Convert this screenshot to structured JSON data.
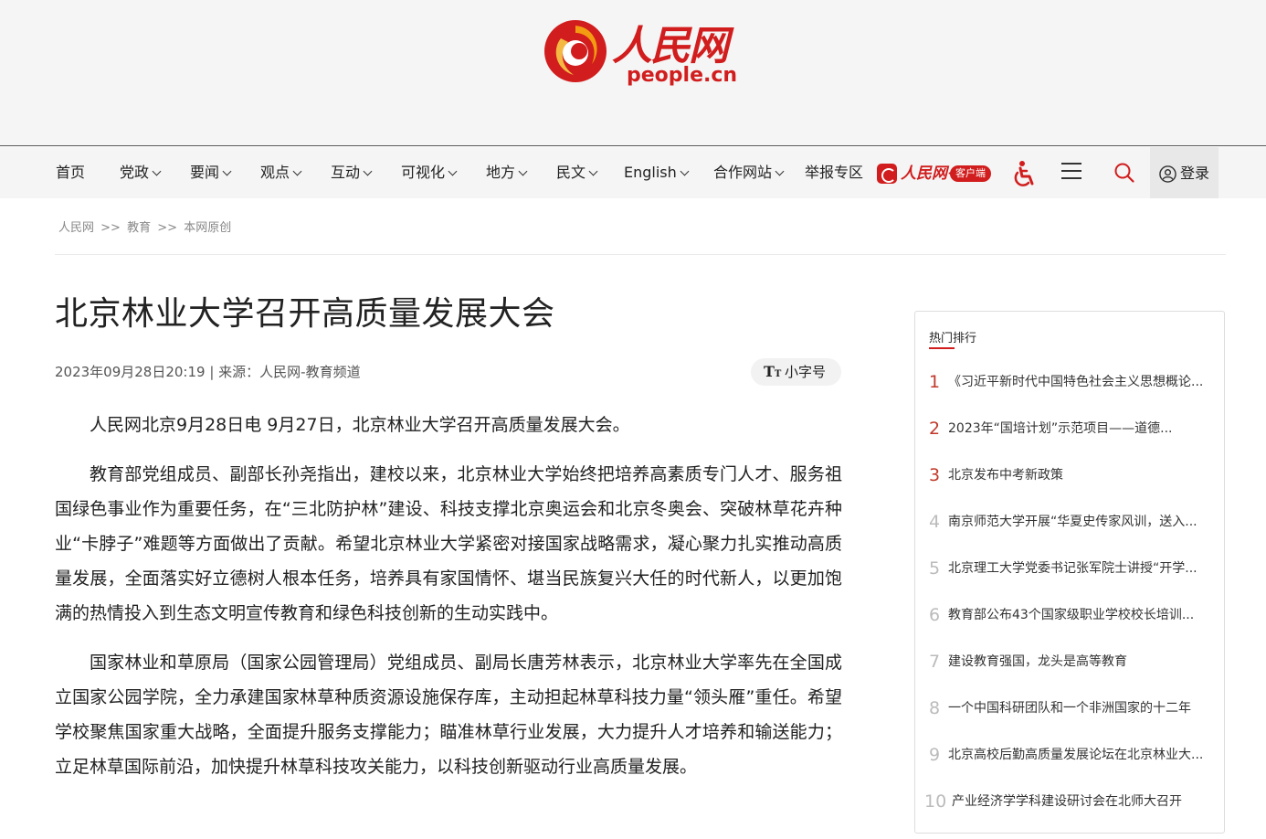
{
  "header": {
    "logo_cn": "人民网",
    "logo_en": "people.cn"
  },
  "nav": {
    "items": [
      {
        "label": "首页"
      },
      {
        "label": "党政"
      },
      {
        "label": "要闻"
      },
      {
        "label": "观点"
      },
      {
        "label": "互动"
      },
      {
        "label": "可视化"
      },
      {
        "label": "地方"
      },
      {
        "label": "民文"
      },
      {
        "label": "English"
      },
      {
        "label": "合作网站"
      },
      {
        "label": "举报专区"
      }
    ],
    "app_name": "人民网+",
    "app_tag": "客户端",
    "login_label": "登录"
  },
  "breadcrumb": {
    "items": [
      "人民网",
      "教育",
      "本网原创"
    ],
    "separator": ">>"
  },
  "article": {
    "title": "北京林业大学召开高质量发展大会",
    "meta": "2023年09月28日20:19 | 来源：人民网-教育频道",
    "font_toggle_label": "小字号",
    "paragraphs": [
      "人民网北京9月28日电 9月27日，北京林业大学召开高质量发展大会。",
      "教育部党组成员、副部长孙尧指出，建校以来，北京林业大学始终把培养高素质专门人才、服务祖国绿色事业作为重要任务，在“三北防护林”建设、科技支撑北京奥运会和北京冬奥会、突破林草花卉种业“卡脖子”难题等方面做出了贡献。希望北京林业大学紧密对接国家战略需求，凝心聚力扎实推动高质量发展，全面落实好立德树人根本任务，培养具有家国情怀、堪当民族复兴大任的时代新人，以更加饱满的热情投入到生态文明宣传教育和绿色科技创新的生动实践中。",
      "国家林业和草原局（国家公园管理局）党组成员、副局长唐芳林表示，北京林业大学率先在全国成立国家公园学院，全力承建国家林草种质资源设施保存库，主动担起林草科技力量“领头雁”重任。希望学校聚焦国家重大战略，全面提升服务支撑能力；瞄准林草行业发展，大力提升人才培养和输送能力；立足林草国际前沿，加快提升林草科技攻关能力，以科技创新驱动行业高质量发展。"
    ]
  },
  "hot": {
    "title": "热门排行",
    "items": [
      {
        "num": "1",
        "text": "《习近平新时代中国特色社会主义思想概论..."
      },
      {
        "num": "2",
        "text": "2023年“国培计划”示范项目——道德..."
      },
      {
        "num": "3",
        "text": "北京发布中考新政策"
      },
      {
        "num": "4",
        "text": "南京师范大学开展“华夏史传家风训，送入..."
      },
      {
        "num": "5",
        "text": "北京理工大学党委书记张军院士讲授“开学..."
      },
      {
        "num": "6",
        "text": "教育部公布43个国家级职业学校校长培训..."
      },
      {
        "num": "7",
        "text": "建设教育强国，龙头是高等教育"
      },
      {
        "num": "8",
        "text": "一个中国科研团队和一个非洲国家的十二年"
      },
      {
        "num": "9",
        "text": "北京高校后勤高质量发展论坛在北京林业大..."
      },
      {
        "num": "10",
        "text": "产业经济学学科建设研讨会在北师大召开"
      }
    ]
  },
  "colors": {
    "brand_red": "#d11d1d",
    "rank_top": "#c0392b",
    "rank_dim": "#bbbbbb"
  },
  "icons": [
    "logo-swirl-icon",
    "app-logo-icon",
    "accessibility-icon",
    "menu-icon",
    "search-icon",
    "user-icon",
    "font-size-icon",
    "chevron-down-icon"
  ]
}
